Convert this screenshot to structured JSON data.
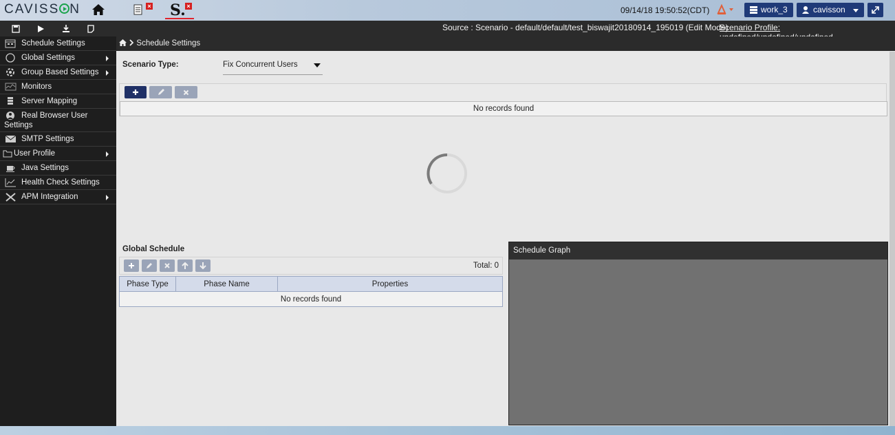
{
  "header": {
    "logo": "CAVISSON",
    "datetime": "09/14/18 19:50:52(CDT)",
    "tab2_label": "S.",
    "close_x": "×",
    "work_label": "work_3",
    "user_label": "cavisson"
  },
  "toolbar": {
    "source": "Source : Scenario - default/default/test_biswajit20180914_195019 (Edit Mode)",
    "profile": "Scenario Profile: undefined/undefined/undefined"
  },
  "sidebar": {
    "items": [
      {
        "label": "Schedule Settings",
        "icon": "schedule-icon"
      },
      {
        "label": "Global Settings",
        "icon": "globe-icon"
      },
      {
        "label": "Group Based Settings",
        "icon": "group-settings-icon"
      },
      {
        "label": "Monitors",
        "icon": "monitor-icon"
      },
      {
        "label": "Server Mapping",
        "icon": "server-icon"
      },
      {
        "label": "Real Browser User Settings",
        "icon": "browser-user-icon"
      },
      {
        "label": "SMTP Settings",
        "icon": "mail-icon"
      },
      {
        "label": "User Profile",
        "icon": "folder-icon"
      },
      {
        "label": "Java Settings",
        "icon": "coffee-icon"
      },
      {
        "label": "Health Check Settings",
        "icon": "health-chart-icon"
      },
      {
        "label": "APM Integration",
        "icon": "tools-icon"
      }
    ]
  },
  "main": {
    "breadcrumb": "Schedule Settings",
    "scenario_type_label": "Scenario Type:",
    "scenario_type_value": "Fix Concurrent Users",
    "upper_no_records": "No records found",
    "global_schedule_title": "Global Schedule",
    "total": "Total: 0",
    "columns": [
      "Phase Type",
      "Phase Name",
      "Properties"
    ],
    "table_no_records": "No records found",
    "graph_title": "Schedule Graph"
  }
}
